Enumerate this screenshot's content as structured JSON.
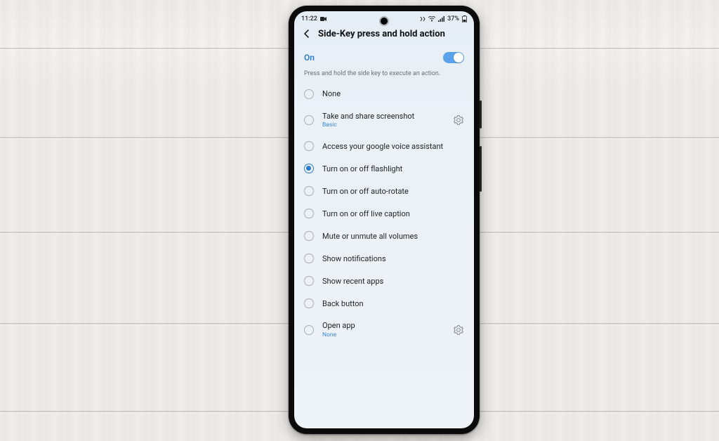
{
  "statusbar": {
    "time": "11:22",
    "battery": "37%"
  },
  "header": {
    "title": "Side-Key press and hold action"
  },
  "master": {
    "state_label": "On",
    "enabled": true
  },
  "help_text": "Press and hold the side key to execute an action.",
  "options": [
    {
      "label": "None",
      "selected": false,
      "sub": null,
      "gear": false
    },
    {
      "label": "Take and share screenshot",
      "selected": false,
      "sub": "Basic",
      "gear": true
    },
    {
      "label": "Access your google voice assistant",
      "selected": false,
      "sub": null,
      "gear": false
    },
    {
      "label": "Turn on or off flashlight",
      "selected": true,
      "sub": null,
      "gear": false
    },
    {
      "label": "Turn on or off auto-rotate",
      "selected": false,
      "sub": null,
      "gear": false
    },
    {
      "label": "Turn on or off live caption",
      "selected": false,
      "sub": null,
      "gear": false
    },
    {
      "label": "Mute or unmute all volumes",
      "selected": false,
      "sub": null,
      "gear": false
    },
    {
      "label": "Show notifications",
      "selected": false,
      "sub": null,
      "gear": false
    },
    {
      "label": "Show recent apps",
      "selected": false,
      "sub": null,
      "gear": false
    },
    {
      "label": "Back button",
      "selected": false,
      "sub": null,
      "gear": false
    },
    {
      "label": "Open app",
      "selected": false,
      "sub": "None",
      "gear": true
    }
  ]
}
